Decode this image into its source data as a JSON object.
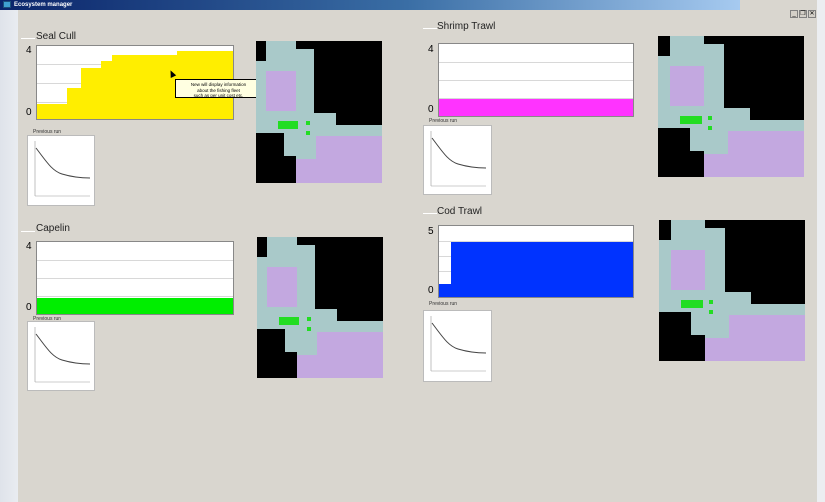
{
  "window": {
    "title": "Ecosystem manager",
    "buttons": [
      "_",
      "❐",
      "✕"
    ]
  },
  "tooltip": {
    "line1": "New will display information",
    "line2": "about the fishing fleet",
    "line3": "such as per unit cost etc."
  },
  "panels": [
    {
      "name": "Seal Cull",
      "ymax": "4",
      "ymin": "0",
      "fill_color": "#ffee00",
      "level": "stepped",
      "mini_label": "Previous run"
    },
    {
      "name": "Capelin",
      "ymax": "4",
      "ymin": "0",
      "fill_color": "#00ee00",
      "level": 0.22,
      "mini_label": "Previous run"
    },
    {
      "name": "Shrimp Trawl",
      "ymax": "4",
      "ymin": "0",
      "fill_color": "#ff33ff",
      "level": 0.24,
      "mini_label": "Previous run"
    },
    {
      "name": "Cod Trawl",
      "ymax": "5",
      "ymin": "0",
      "fill_color": "#0033ff",
      "level": 0.82,
      "mini_label": "Previous run"
    }
  ],
  "colors": {
    "map_water": "#a9c9c9",
    "map_land": "#000000",
    "map_purple": "#c3a8e0",
    "map_marker": "#22dd22"
  }
}
